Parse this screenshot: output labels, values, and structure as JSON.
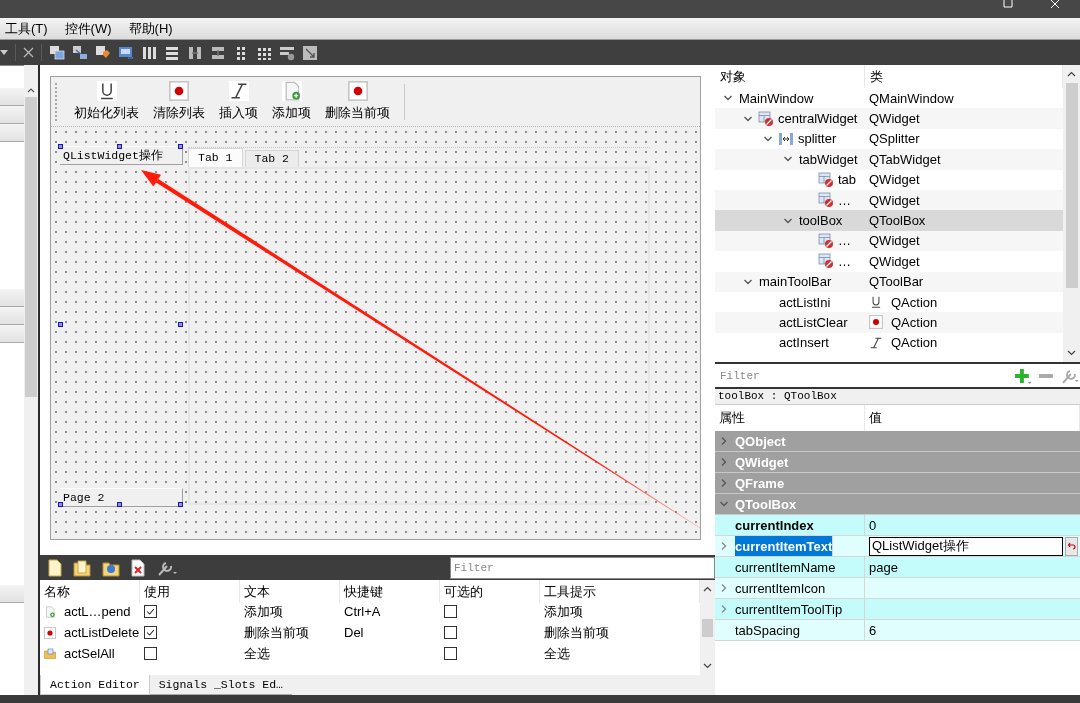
{
  "menu": [
    "工具(T)",
    "控件(W)",
    "帮助(H)"
  ],
  "form": {
    "toolbar": [
      {
        "label": "初始化列表",
        "kind": "underline"
      },
      {
        "label": "清除列表",
        "kind": "record"
      },
      {
        "label": "插入项",
        "kind": "italic"
      },
      {
        "label": "添加项",
        "kind": "new-item"
      },
      {
        "label": "删除当前项",
        "kind": "record"
      }
    ],
    "toolbox": {
      "pages": [
        "QListWidget操作",
        "Page 2"
      ]
    },
    "tab_widget": {
      "tabs": [
        {
          "label": "Tab 1",
          "selected": true
        },
        {
          "label": "Tab 2",
          "selected": false
        }
      ]
    }
  },
  "action_editor": {
    "filter": {
      "placeholder": "Filter"
    },
    "columns": [
      "名称",
      "使用",
      "文本",
      "快捷键",
      "可选的",
      "工具提示"
    ],
    "rows": [
      {
        "name": "actL…pend",
        "kind": "new-item",
        "used": true,
        "text": "添加项",
        "shortcut": "Ctrl+A",
        "checkable": false,
        "tooltip": "添加项"
      },
      {
        "name": "actListDelete",
        "kind": "record",
        "used": true,
        "text": "删除当前项",
        "shortcut": "Del",
        "checkable": false,
        "tooltip": "删除当前项"
      },
      {
        "name": "actSelAll",
        "kind": "folder",
        "used": false,
        "text": "全选",
        "checkable": false,
        "tooltip": "全选"
      }
    ],
    "tabs": [
      {
        "label": "Action Editor",
        "selected": true
      },
      {
        "label": "Signals _Slots Ed…",
        "selected": false
      }
    ]
  },
  "object_inspector": {
    "columns": [
      "对象",
      "类"
    ],
    "tree": [
      {
        "name": "MainWindow",
        "class": "QMainWindow",
        "expanded": true,
        "selected": false,
        "children": [
          {
            "name": "centralWidget",
            "class": "QWidget",
            "kind": "widget",
            "expanded": true,
            "selected": false,
            "children": [
              {
                "name": "splitter",
                "class": "QSplitter",
                "kind": "splitter",
                "expanded": true,
                "selected": false,
                "children": [
                  {
                    "name": "tabWidget",
                    "class": "QTabWidget",
                    "expanded": true,
                    "selected": false,
                    "children": [
                      {
                        "name": "tab",
                        "class": "QWidget",
                        "kind": "widget",
                        "selected": false
                      },
                      {
                        "name": "…",
                        "class": "QWidget",
                        "kind": "widget",
                        "selected": false
                      }
                    ]
                  },
                  {
                    "name": "toolBox",
                    "class": "QToolBox",
                    "expanded": true,
                    "selected": true,
                    "children": [
                      {
                        "name": "…",
                        "class": "QWidget",
                        "kind": "widget",
                        "selected": false
                      },
                      {
                        "name": "…",
                        "class": "QWidget",
                        "kind": "widget",
                        "selected": false
                      }
                    ]
                  }
                ]
              }
            ]
          },
          {
            "name": "mainToolBar",
            "class": "QToolBar",
            "expanded": true,
            "selected": false,
            "children": [
              {
                "name": "actListIni",
                "class": "QAction",
                "kind": "underline",
                "selected": false
              },
              {
                "name": "actListClear",
                "class": "QAction",
                "kind": "record",
                "selected": false
              },
              {
                "name": "actInsert",
                "class": "QAction",
                "kind": "italic",
                "selected": false
              }
            ]
          }
        ]
      }
    ]
  },
  "property_editor": {
    "filter": {
      "placeholder": "Filter"
    },
    "object_label": "toolBox : QToolBox",
    "columns": [
      "属性",
      "值"
    ],
    "rows": [
      {
        "kind": "group",
        "name": "QObject",
        "expanded": false
      },
      {
        "kind": "group",
        "name": "QWidget",
        "expanded": false
      },
      {
        "kind": "group",
        "name": "QFrame",
        "expanded": false
      },
      {
        "kind": "group",
        "name": "QToolBox",
        "expanded": true
      },
      {
        "kind": "property",
        "name": "currentIndex",
        "value": "0",
        "changed": true,
        "expandable": false,
        "selected": false
      },
      {
        "kind": "property",
        "name": "currentItemText",
        "value": "QListWidget操作",
        "changed": true,
        "expandable": true,
        "selected": true
      },
      {
        "kind": "property",
        "name": "currentItemName",
        "value": "page",
        "changed": false,
        "expandable": false,
        "selected": false
      },
      {
        "kind": "property",
        "name": "currentItemIcon",
        "changed": false,
        "expandable": true,
        "selected": false
      },
      {
        "kind": "property",
        "name": "currentItemToolTip",
        "changed": false,
        "expandable": true,
        "selected": false
      },
      {
        "kind": "property",
        "name": "tabSpacing",
        "value": "6",
        "changed": false,
        "expandable": false,
        "selected": false
      }
    ]
  }
}
